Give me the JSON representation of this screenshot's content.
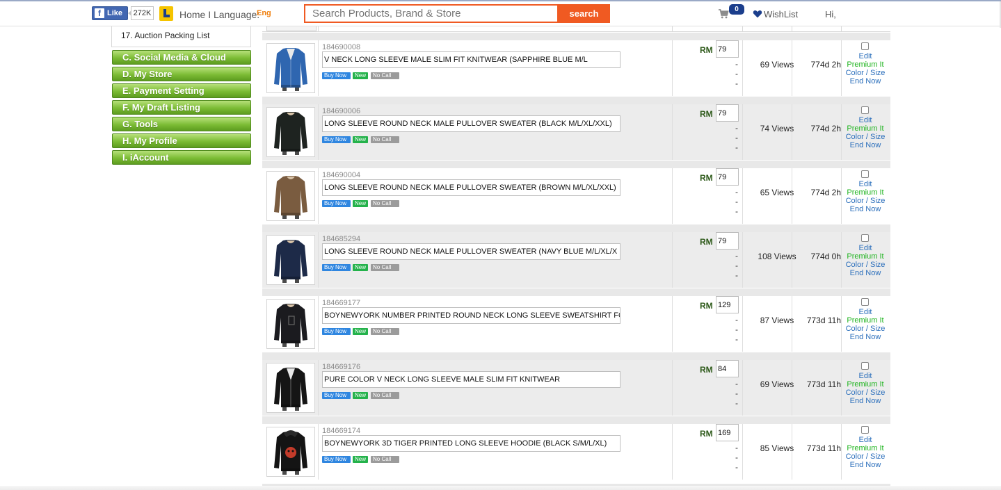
{
  "topbar": {
    "fb_like": "Like",
    "fb_count": "272K",
    "home_language": "Home I Language:",
    "language": "Eng",
    "search_placeholder": "Search Products, Brand & Store",
    "search_button": "search",
    "cart_count": "0",
    "wishlist": "WishList",
    "greeting": "Hi,"
  },
  "sidebar": {
    "packing_item": "17. Auction Packing List",
    "sections": [
      "C. Social Media & Cloud",
      "D. My Store",
      "E. Payment Setting",
      "F. My Draft Listing",
      "G. Tools",
      "H. My Profile",
      "I. iAccount"
    ]
  },
  "colors": {
    "accent_orange": "#f05a22",
    "sidebar_green": "#7cbc35",
    "link_blue": "#2a6ebb",
    "premium_green": "#1db31d",
    "currency_green": "#2e5a1a"
  },
  "listing": {
    "badges": {
      "buy_now": "Buy Now",
      "new": "New",
      "no_call": "No Call"
    },
    "currency": "RM",
    "dash": "-",
    "actions": {
      "edit": "Edit",
      "premium": "Premium It",
      "color_size": "Color / Size",
      "end_now": "End Now"
    },
    "items": [
      {
        "sku": "184690008",
        "title": "V NECK LONG SLEEVE MALE SLIM FIT KNITWEAR (SAPPHIRE BLUE M/L",
        "price": "79",
        "views": "69 Views",
        "time_left": "774d 2h",
        "garment_color": "#2f66b0",
        "neck": "v"
      },
      {
        "sku": "184690006",
        "title": "LONG SLEEVE ROUND NECK MALE PULLOVER SWEATER (BLACK M/L/XL/XXL)",
        "price": "79",
        "views": "74 Views",
        "time_left": "774d 2h",
        "garment_color": "#1e2320",
        "neck": "round"
      },
      {
        "sku": "184690004",
        "title": "LONG SLEEVE ROUND NECK MALE PULLOVER SWEATER (BROWN M/L/XL/XXL)",
        "price": "79",
        "views": "65 Views",
        "time_left": "774d 2h",
        "garment_color": "#7a5c40",
        "neck": "round"
      },
      {
        "sku": "184685294",
        "title": "LONG SLEEVE ROUND NECK MALE PULLOVER SWEATER (NAVY BLUE M/L/XL/X",
        "price": "79",
        "views": "108 Views",
        "time_left": "774d 0h",
        "garment_color": "#1d2a48",
        "neck": "round"
      },
      {
        "sku": "184669177",
        "title": "BOYNEWYORK NUMBER PRINTED ROUND NECK LONG SLEEVE SWEATSHIRT FO",
        "price": "129",
        "views": "87 Views",
        "time_left": "773d 11h",
        "garment_color": "#1b1b1f",
        "neck": "round"
      },
      {
        "sku": "184669176",
        "title": "PURE COLOR V NECK LONG SLEEVE MALE SLIM FIT KNITWEAR",
        "price": "84",
        "views": "69 Views",
        "time_left": "773d 11h",
        "garment_color": "#151515",
        "neck": "v"
      },
      {
        "sku": "184669174",
        "title": "BOYNEWYORK 3D TIGER PRINTED LONG SLEEVE HOODIE (BLACK S/M/L/XL)",
        "price": "169",
        "views": "85 Views",
        "time_left": "773d 11h",
        "garment_color": "#141414",
        "neck": "hood"
      }
    ]
  }
}
